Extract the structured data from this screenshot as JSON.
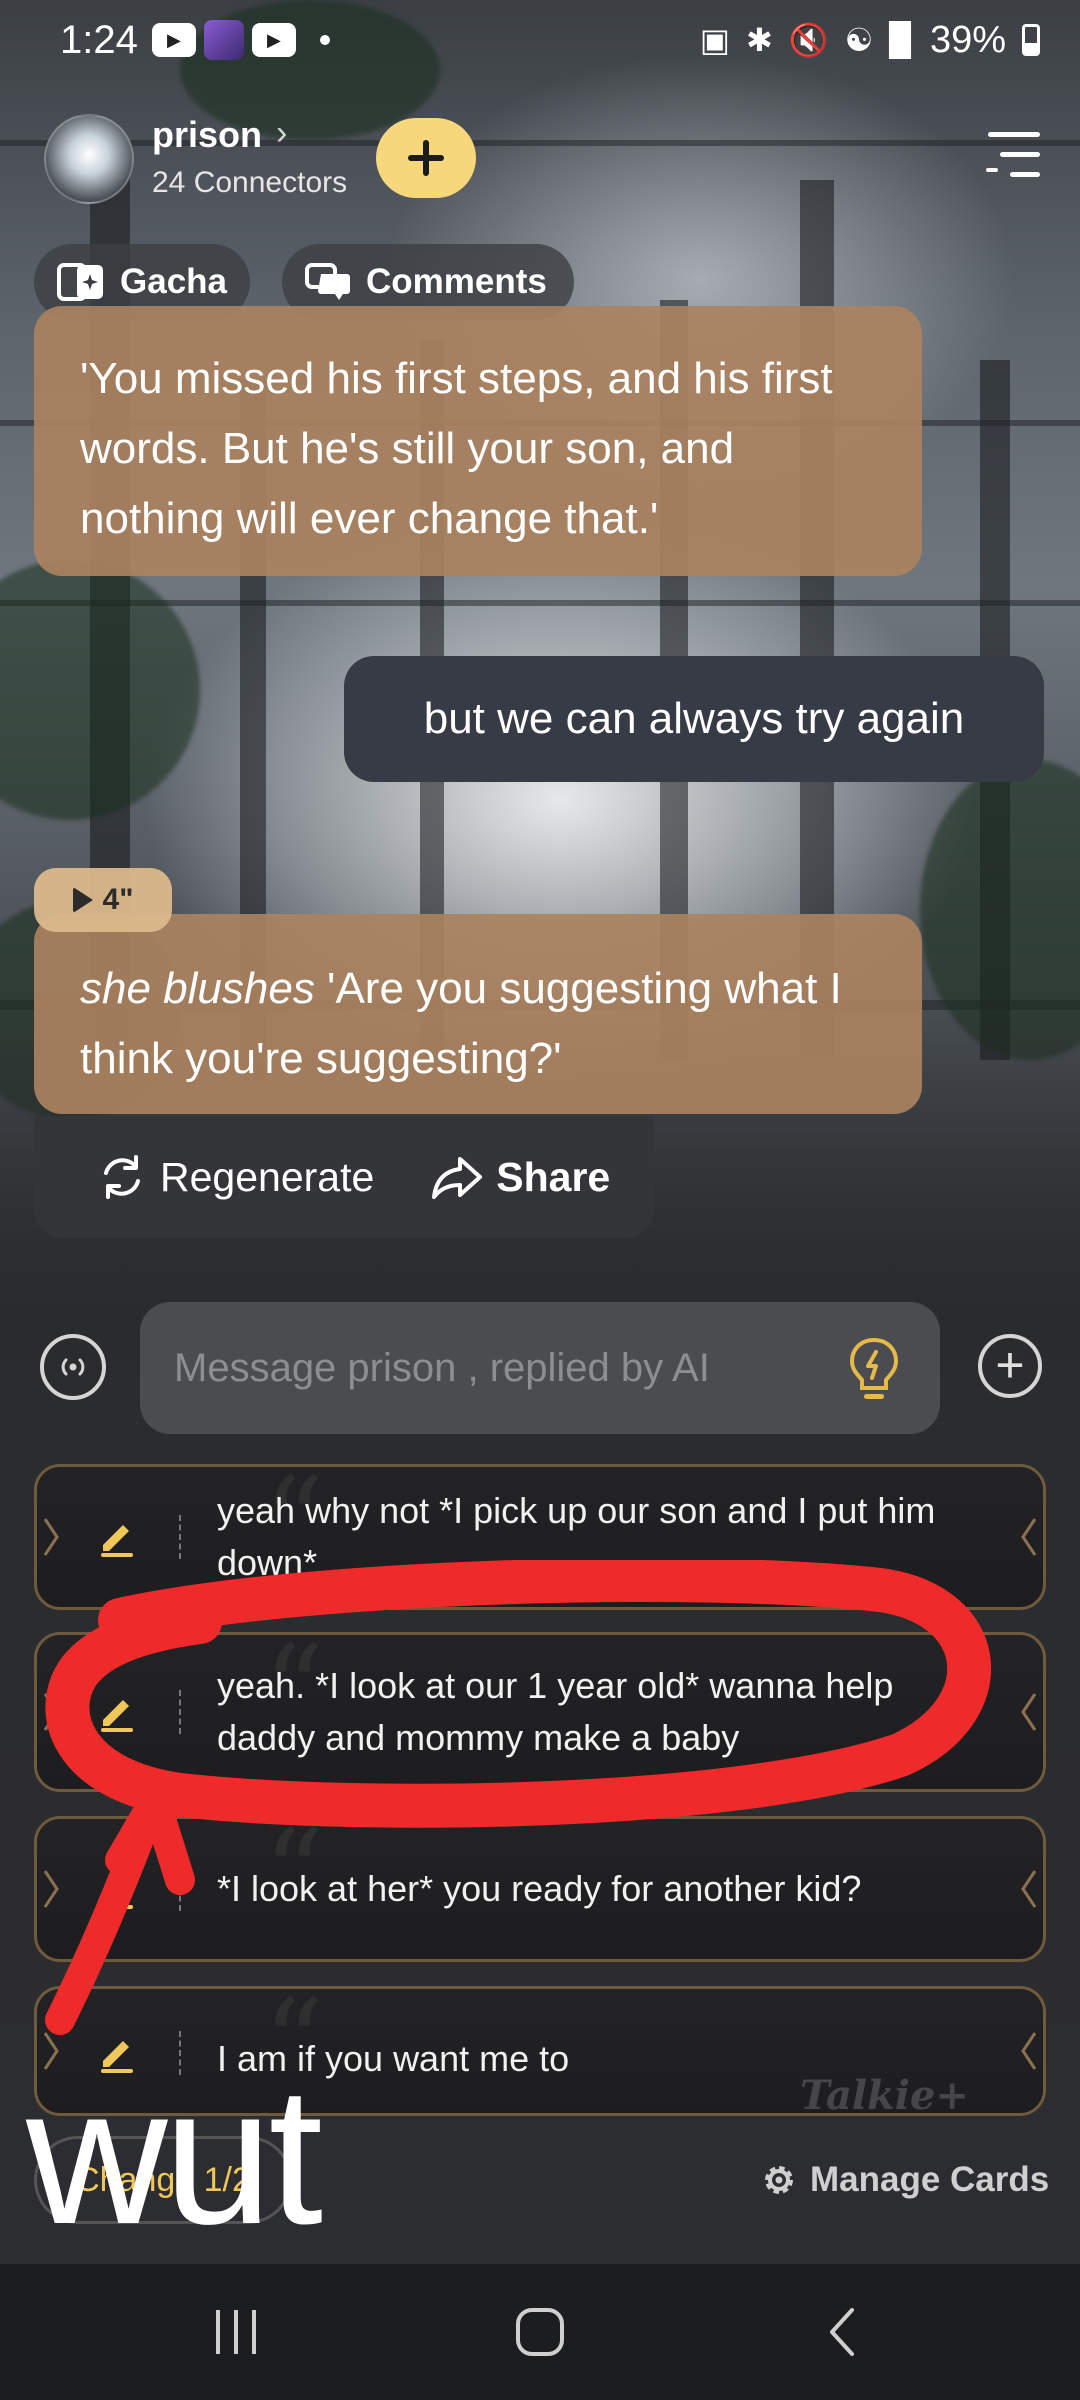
{
  "status_bar": {
    "time": "1:24",
    "battery": "39%"
  },
  "header": {
    "bot_name": "prison",
    "connectors": "24 Connectors"
  },
  "tabs": {
    "gacha": "Gacha",
    "comments": "Comments"
  },
  "messages": [
    {
      "role": "bot",
      "text": "'You missed his first steps, and his first words. But he's still your son, and nothing will ever change that.'"
    },
    {
      "role": "user",
      "text": "but we can always try again"
    },
    {
      "role": "bot",
      "action": "she blushes",
      "text": " 'Are you suggesting what I think you're suggesting?'",
      "duration": "4\""
    }
  ],
  "actions": {
    "regenerate": "Regenerate",
    "share": "Share"
  },
  "input": {
    "placeholder": "Message prison , replied by AI"
  },
  "suggestions": [
    "yeah why not  *I pick up our son and I put him down*",
    "yeah. *I look at our 1 year old* wanna help daddy and mommy make a baby",
    "*I look at her* you ready for another kid?",
    "I am if you want me to"
  ],
  "watermark": "Talkie+",
  "footer": {
    "change": "Change 1/2",
    "manage_cards": "Manage Cards"
  },
  "annotation": {
    "caption": "wut",
    "color": "#ee2a2a"
  },
  "colors": {
    "bot_bubble": "#aa825f",
    "user_bubble": "#373b46",
    "accent_yellow": "#f6d77b"
  }
}
